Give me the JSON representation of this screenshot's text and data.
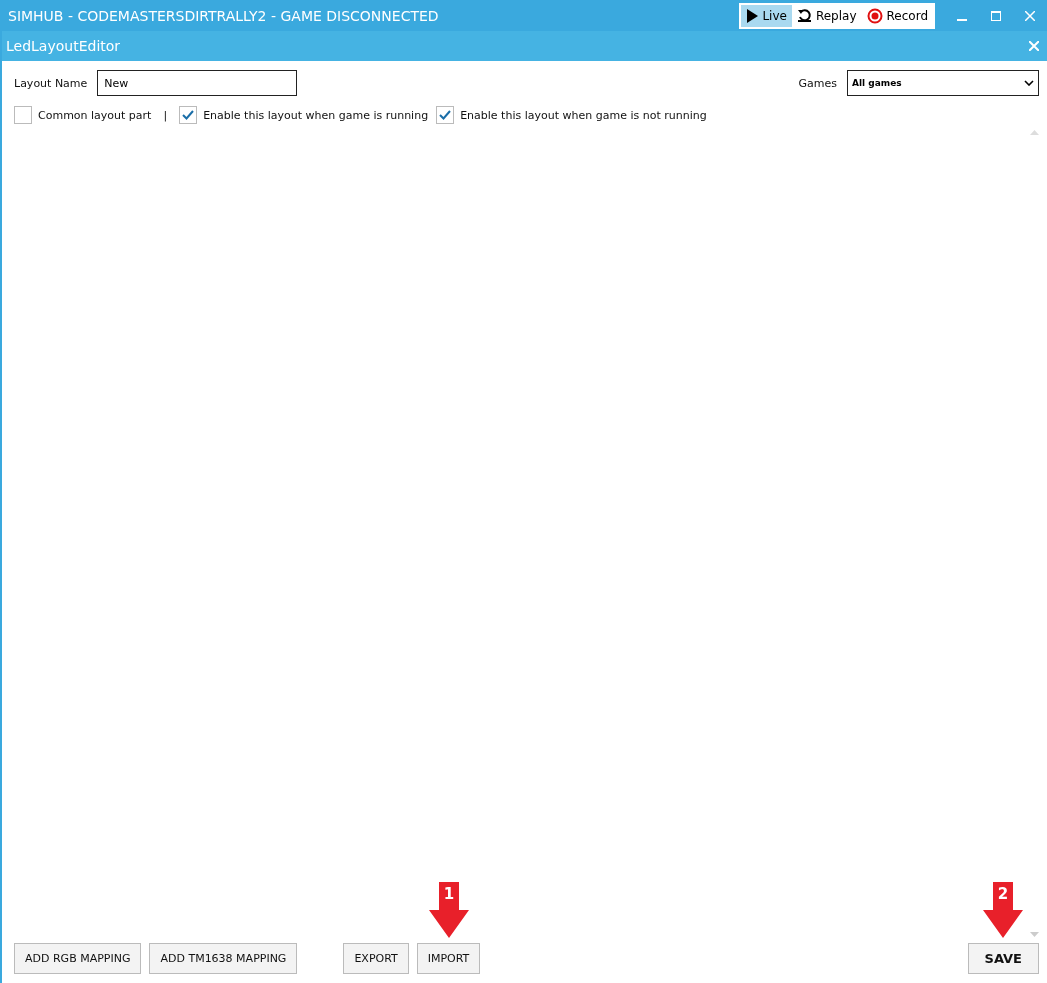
{
  "window": {
    "title": "SIMHUB - CODEMASTERSDIRTRALLY2 - GAME DISCONNECTED"
  },
  "modes": [
    {
      "label": "Live",
      "kind": "play",
      "selected": true
    },
    {
      "label": "Replay",
      "kind": "replay",
      "selected": false
    },
    {
      "label": "Record",
      "kind": "record",
      "selected": false
    }
  ],
  "panel": {
    "title": "LedLayoutEditor"
  },
  "layout_name": {
    "label": "Layout Name",
    "value": "New"
  },
  "games": {
    "label": "Games",
    "value": "All games"
  },
  "options": [
    {
      "label": "Common layout part",
      "checked": false
    },
    {
      "label": "Enable this layout when game is running",
      "checked": true
    },
    {
      "label": "Enable this layout when game is not running",
      "checked": true
    }
  ],
  "separator": "|",
  "buttons_left": [
    "ADD RGB MAPPING",
    "ADD TM1638 MAPPING"
  ],
  "buttons_mid": [
    {
      "label": "EXPORT"
    },
    {
      "label": "IMPORT",
      "callout": "1"
    }
  ],
  "save": {
    "label": "SAVE",
    "callout": "2"
  }
}
